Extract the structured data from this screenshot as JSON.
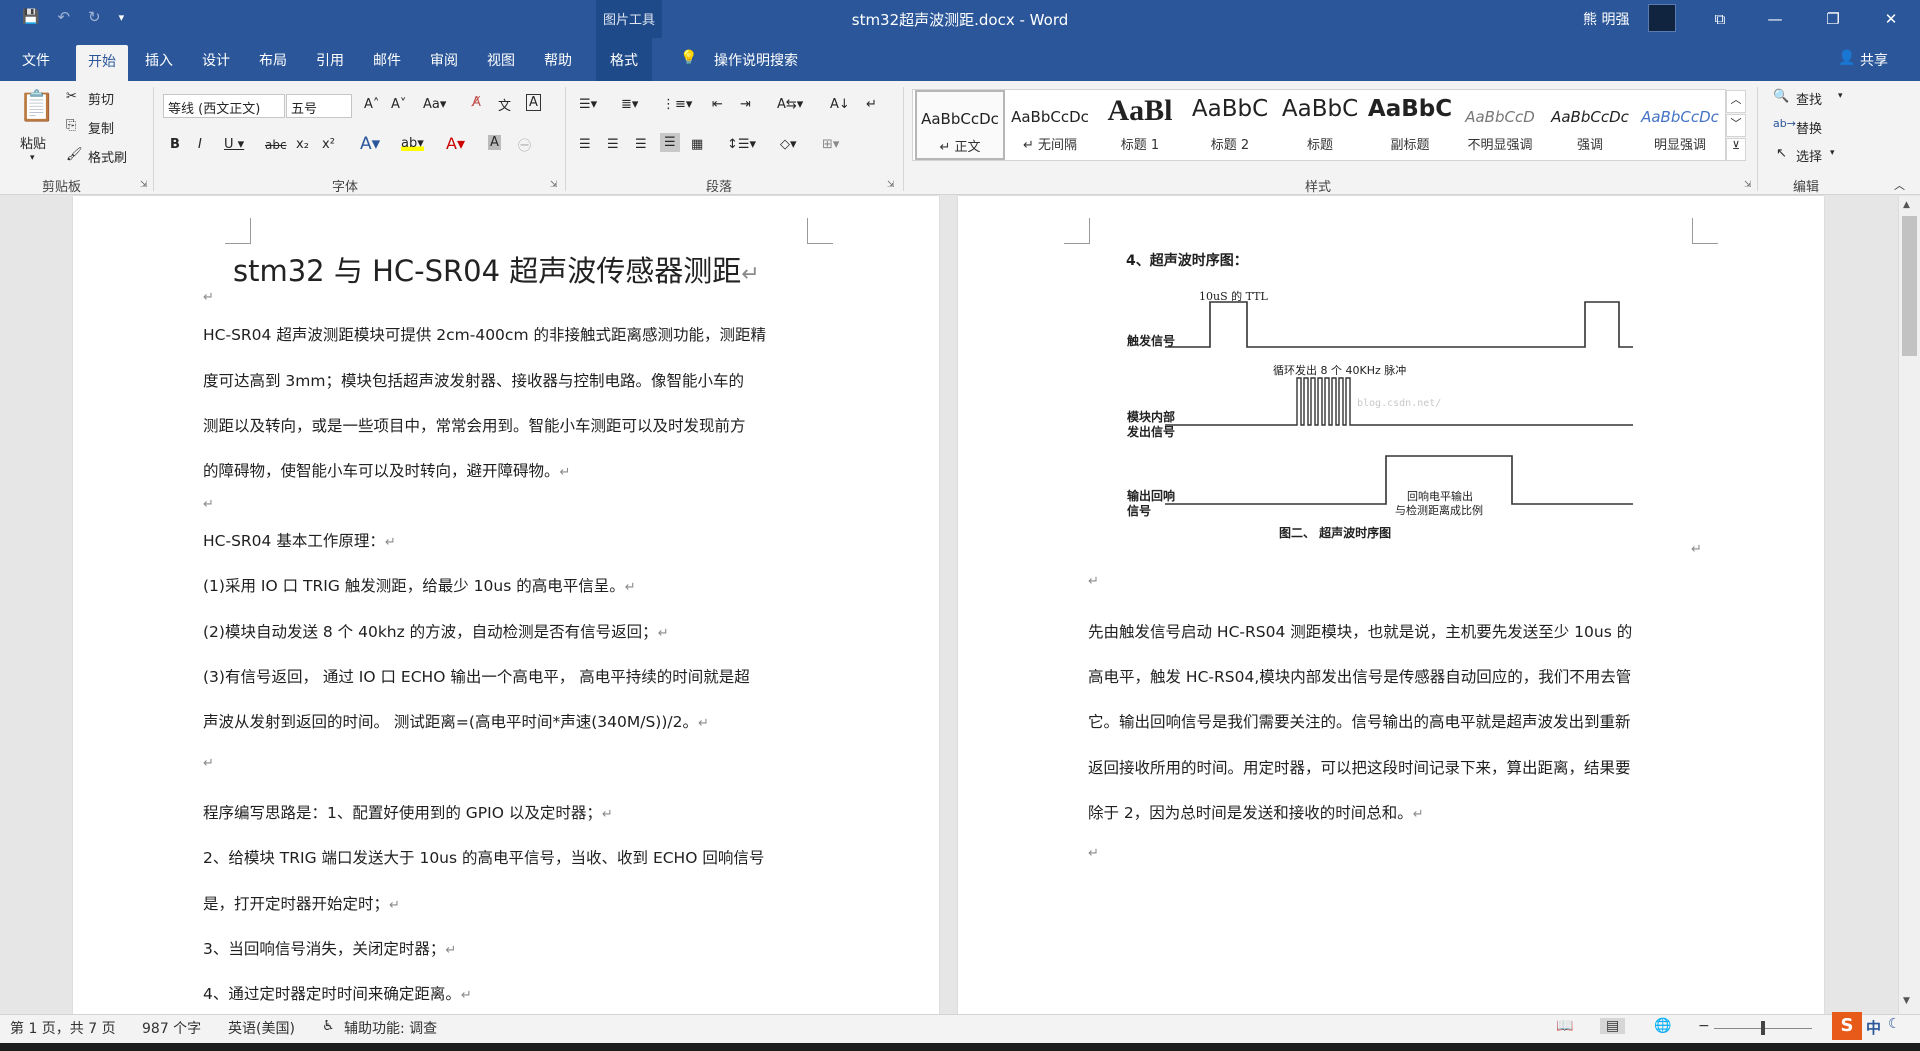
{
  "window": {
    "title": "stm32超声波测距.docx - Word",
    "context_group": "图片工具",
    "user": "熊 明强",
    "minimize": "—",
    "restore": "❐",
    "close": "✕",
    "ribbon_display": "⧉"
  },
  "qat": {
    "save": "💾",
    "undo": "↶",
    "redo": "↻",
    "customize": "▾"
  },
  "tabs": [
    "文件",
    "开始",
    "插入",
    "设计",
    "布局",
    "引用",
    "邮件",
    "审阅",
    "视图",
    "帮助"
  ],
  "ctx_tab": "格式",
  "tell_me": "操作说明搜索",
  "share": "共享",
  "clipboard": {
    "paste": "粘贴",
    "cut": "剪切",
    "copy": "复制",
    "format_painter": "格式刷",
    "label": "剪贴板"
  },
  "font": {
    "name": "等线 (西文正文)",
    "size": "五号",
    "label": "字体"
  },
  "paragraph": {
    "label": "段落"
  },
  "styles": {
    "label": "样式",
    "items": [
      {
        "sample": "AaBbCcDc",
        "name": "正文"
      },
      {
        "sample": "AaBbCcDc",
        "name": "无间隔"
      },
      {
        "sample": "AaBl",
        "name": "标题 1"
      },
      {
        "sample": "AaBbC",
        "name": "标题 2"
      },
      {
        "sample": "AaBbC",
        "name": "标题"
      },
      {
        "sample": "AaBbC",
        "name": "副标题"
      },
      {
        "sample": "AaBbCcD",
        "name": "不明显强调"
      },
      {
        "sample": "AaBbCcDc",
        "name": "强调"
      },
      {
        "sample": "AaBbCcDc",
        "name": "明显强调"
      }
    ]
  },
  "editing": {
    "find": "查找",
    "replace": "替换",
    "select": "选择",
    "label": "编辑"
  },
  "page1": {
    "title": "stm32 与 HC-SR04 超声波传感器测距",
    "lines": [
      "HC-SR04 超声波测距模块可提供 2cm-400cm 的非接触式距离感测功能，测距精",
      "度可达高到 3mm；模块包括超声波发射器、接收器与控制电路。像智能小车的",
      "测距以及转向，或是一些项目中，常常会用到。智能小车测距可以及时发现前方",
      "的障碍物，使智能小车可以及时转向，避开障碍物。",
      "HC-SR04 基本工作原理：",
      "(1)采用 IO 口 TRIG 触发测距，给最少 10us 的高电平信呈。",
      "(2)模块自动发送 8 个 40khz 的方波，自动检测是否有信号返回；",
      "(3)有信号返回，  通过 IO 口 ECHO 输出一个高电平，  高电平持续的时间就是超",
      "声波从发射到返回的时间。  测试距离=(高电平时间*声速(340M/S))/2。",
      "程序编写思路是：1、配置好使用到的 GPIO 以及定时器；",
      "2、给模块 TRIG 端口发送大于 10us 的高电平信号，当收、收到 ECHO 回响信号",
      "是，打开定时器开始定时；",
      "3、当回响信号消失，关闭定时器；",
      "4、通过定时器定时时间来确定距离。"
    ]
  },
  "page2": {
    "heading": "4、超声波时序图：",
    "diagram": {
      "ttl_label": "10uS 的 TTL",
      "burst_label": "循环发出 8 个 40KHz 脉冲",
      "watermark": "blog.csdn.net/",
      "row1": "触发信号",
      "row2a": "模块内部",
      "row2b": "发出信号",
      "row3a": "输出回响",
      "row3b": "信号",
      "echo_a": "回响电平输出",
      "echo_b": "与检测距离成比例",
      "caption": "图二、  超声波时序图"
    },
    "lines": [
      "先由触发信号启动 HC-RS04 测距模块，也就是说，主机要先发送至少 10us 的",
      "高电平，触发 HC-RS04,模块内部发出信号是传感器自动回应的，我们不用去管",
      "它。输出回响信号是我们需要关注的。信号输出的高电平就是超声波发出到重新",
      "返回接收所用的时间。用定时器，可以把这段时间记录下来，算出距离，结果要",
      "除于 2，因为总时间是发送和接收的时间总和。"
    ]
  },
  "status": {
    "page": "第 1 页，共 7 页",
    "words": "987 个字",
    "lang": "英语(美国)",
    "access": "辅助功能: 调查"
  },
  "ime": {
    "logo": "S",
    "mode": "中"
  }
}
